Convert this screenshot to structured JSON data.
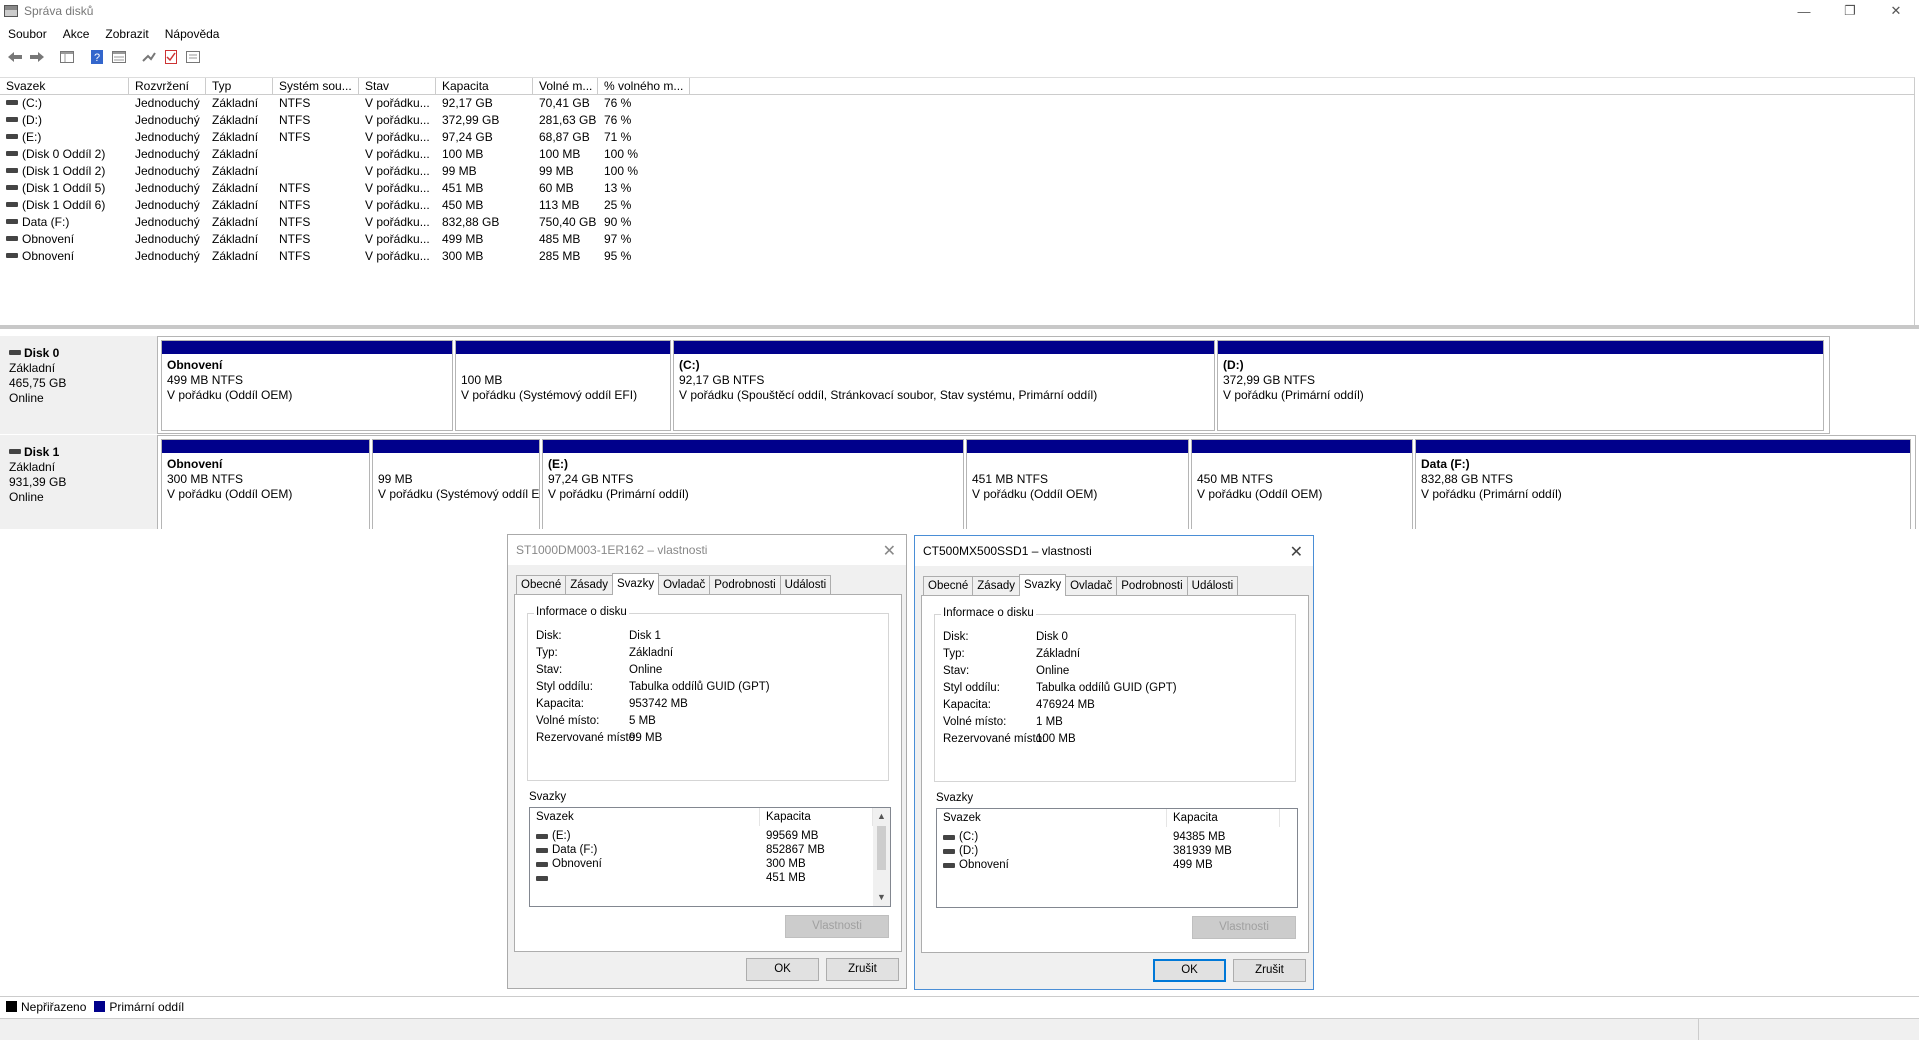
{
  "window": {
    "title": "Správa disků",
    "controls": [
      "—",
      "❐",
      "✕"
    ]
  },
  "menu": [
    "Soubor",
    "Akce",
    "Zobrazit",
    "Nápověda"
  ],
  "toolbar": [
    "back-icon",
    "forward-icon",
    "list-view-icon",
    "help-icon",
    "properties-icon",
    "connect-icon",
    "checklist-icon",
    "details-icon"
  ],
  "volume_list": {
    "columns": [
      "Svazek",
      "Rozvržení",
      "Typ",
      "Systém sou...",
      "Stav",
      "Kapacita",
      "Volné m...",
      "% volného m..."
    ],
    "rows": [
      [
        "(C:)",
        "Jednoduchý",
        "Základní",
        "NTFS",
        "V pořádku...",
        "92,17 GB",
        "70,41 GB",
        "76 %"
      ],
      [
        "(D:)",
        "Jednoduchý",
        "Základní",
        "NTFS",
        "V pořádku...",
        "372,99 GB",
        "281,63 GB",
        "76 %"
      ],
      [
        "(E:)",
        "Jednoduchý",
        "Základní",
        "NTFS",
        "V pořádku...",
        "97,24 GB",
        "68,87 GB",
        "71 %"
      ],
      [
        "(Disk 0 Oddíl 2)",
        "Jednoduchý",
        "Základní",
        "",
        "V pořádku...",
        "100 MB",
        "100 MB",
        "100 %"
      ],
      [
        "(Disk 1 Oddíl 2)",
        "Jednoduchý",
        "Základní",
        "",
        "V pořádku...",
        "99 MB",
        "99 MB",
        "100 %"
      ],
      [
        "(Disk 1 Oddíl 5)",
        "Jednoduchý",
        "Základní",
        "NTFS",
        "V pořádku...",
        "451 MB",
        "60 MB",
        "13 %"
      ],
      [
        "(Disk 1 Oddíl 6)",
        "Jednoduchý",
        "Základní",
        "NTFS",
        "V pořádku...",
        "450 MB",
        "113 MB",
        "25 %"
      ],
      [
        "Data (F:)",
        "Jednoduchý",
        "Základní",
        "NTFS",
        "V pořádku...",
        "832,88 GB",
        "750,40 GB",
        "90 %"
      ],
      [
        "Obnovení",
        "Jednoduchý",
        "Základní",
        "NTFS",
        "V pořádku...",
        "499 MB",
        "485 MB",
        "97 %"
      ],
      [
        "Obnovení",
        "Jednoduchý",
        "Základní",
        "NTFS",
        "V pořádku...",
        "300 MB",
        "285 MB",
        "95 %"
      ]
    ]
  },
  "disks": [
    {
      "name": "Disk 0",
      "type": "Základní",
      "size": "465,75 GB",
      "status": "Online",
      "partitions": [
        {
          "title": "Obnovení",
          "size": "499 MB NTFS",
          "status": "V pořádku (Oddíl OEM)"
        },
        {
          "title": "",
          "size": "100 MB",
          "status": "V pořádku (Systémový oddíl EFI)"
        },
        {
          "title": "(C:)",
          "size": "92,17 GB NTFS",
          "status": "V pořádku (Spouštěcí oddíl, Stránkovací soubor, Stav systému, Primární oddíl)"
        },
        {
          "title": "(D:)",
          "size": "372,99 GB NTFS",
          "status": "V pořádku (Primární oddíl)"
        }
      ]
    },
    {
      "name": "Disk 1",
      "type": "Základní",
      "size": "931,39 GB",
      "status": "Online",
      "partitions": [
        {
          "title": "Obnovení",
          "size": "300 MB NTFS",
          "status": "V pořádku (Oddíl OEM)"
        },
        {
          "title": "",
          "size": "99 MB",
          "status": "V pořádku (Systémový oddíl EFI)"
        },
        {
          "title": "(E:)",
          "size": "97,24 GB NTFS",
          "status": "V pořádku (Primární oddíl)"
        },
        {
          "title": "",
          "size": "451 MB NTFS",
          "status": "V pořádku (Oddíl OEM)"
        },
        {
          "title": "",
          "size": "450 MB NTFS",
          "status": "V pořádku (Oddíl OEM)"
        },
        {
          "title": "Data  (F:)",
          "size": "832,88 GB NTFS",
          "status": "V pořádku (Primární oddíl)"
        }
      ]
    }
  ],
  "legend": [
    {
      "label": "Nepřiřazeno",
      "color": "#000000"
    },
    {
      "label": "Primární oddíl",
      "color": "#00008b"
    }
  ],
  "dialogs": [
    {
      "title": "ST1000DM003-1ER162 – vlastnosti",
      "tabs": [
        "Obecné",
        "Zásady",
        "Svazky",
        "Ovladač",
        "Podrobnosti",
        "Události"
      ],
      "selected_tab": "Svazky",
      "group_title": "Informace o disku",
      "info": [
        [
          "Disk:",
          "Disk 1"
        ],
        [
          "Typ:",
          "Základní"
        ],
        [
          "Stav:",
          "Online"
        ],
        [
          "Styl oddílu:",
          "Tabulka oddílů GUID (GPT)"
        ],
        [
          "Kapacita:",
          "953742 MB"
        ],
        [
          "Volné místo:",
          "5 MB"
        ],
        [
          "Rezervované místo:",
          "99 MB"
        ]
      ],
      "volumes_label": "Svazky",
      "volumes_columns": [
        "Svazek",
        "Kapacita"
      ],
      "volumes": [
        [
          "(E:)",
          "99569 MB"
        ],
        [
          "Data (F:)",
          "852867 MB"
        ],
        [
          "Obnovení",
          "300 MB"
        ],
        [
          "",
          "451 MB"
        ]
      ],
      "properties_button": "Vlastnosti",
      "ok": "OK",
      "cancel": "Zrušit"
    },
    {
      "title": "CT500MX500SSD1 – vlastnosti",
      "tabs": [
        "Obecné",
        "Zásady",
        "Svazky",
        "Ovladač",
        "Podrobnosti",
        "Události"
      ],
      "selected_tab": "Svazky",
      "group_title": "Informace o disku",
      "info": [
        [
          "Disk:",
          "Disk 0"
        ],
        [
          "Typ:",
          "Základní"
        ],
        [
          "Stav:",
          "Online"
        ],
        [
          "Styl oddílu:",
          "Tabulka oddílů GUID (GPT)"
        ],
        [
          "Kapacita:",
          "476924 MB"
        ],
        [
          "Volné místo:",
          "1 MB"
        ],
        [
          "Rezervované místo:",
          "100 MB"
        ]
      ],
      "volumes_label": "Svazky",
      "volumes_columns": [
        "Svazek",
        "Kapacita"
      ],
      "volumes": [
        [
          "(C:)",
          "94385 MB"
        ],
        [
          "(D:)",
          "381939 MB"
        ],
        [
          "Obnovení",
          "499 MB"
        ]
      ],
      "properties_button": "Vlastnosti",
      "ok": "OK",
      "cancel": "Zrušit"
    }
  ]
}
